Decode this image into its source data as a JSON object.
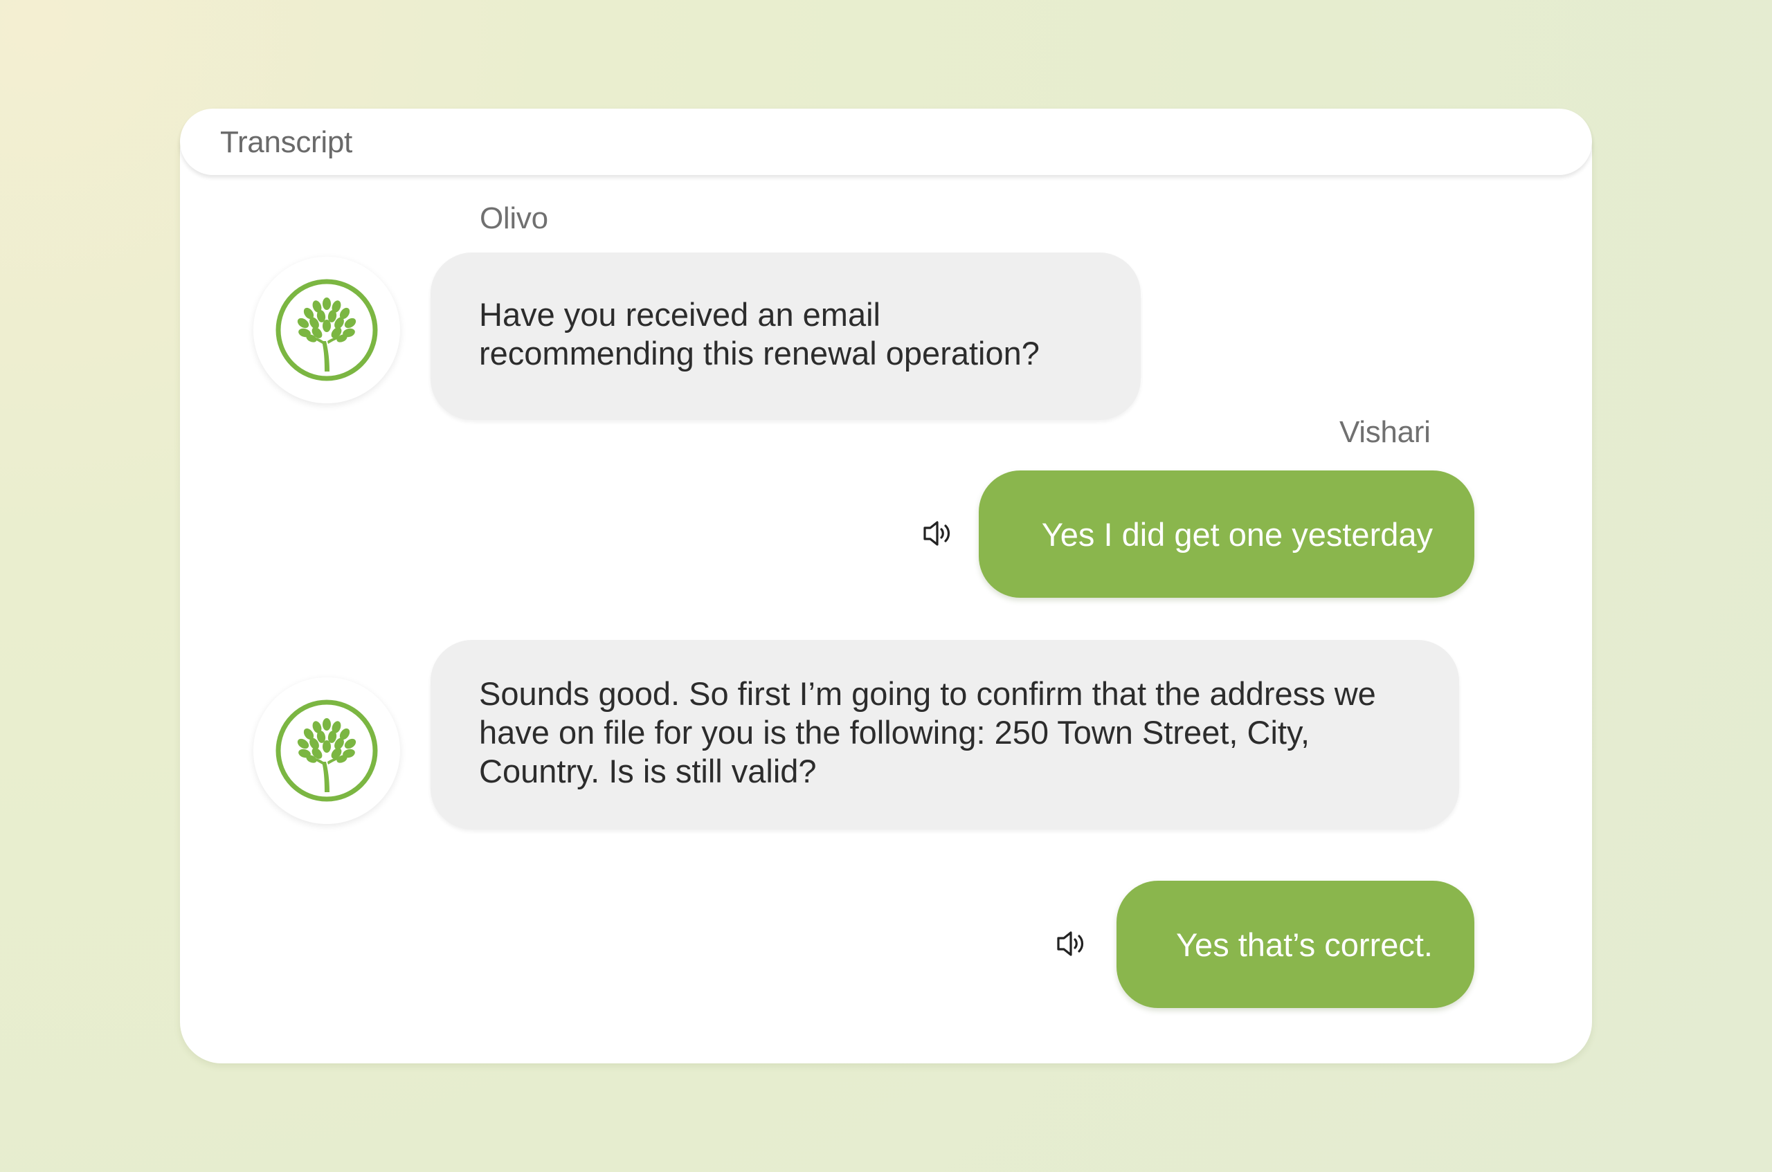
{
  "transcript": {
    "title": "Transcript"
  },
  "messages": [
    {
      "role": "bot",
      "sender": "Olivo",
      "text_lines": [
        "Have you received an email",
        "recommending this renewal operation?"
      ],
      "avatar_icon": "tree-logo-icon"
    },
    {
      "role": "user",
      "sender": "Vishari",
      "text": "Yes I did get one yesterday",
      "action_icon": "speaker-icon"
    },
    {
      "role": "bot",
      "text_lines": [
        "Sounds good. So first I’m going to confirm that the address we",
        "have on file for you is the following: 250 Town Street, City,",
        "Country. Is is still valid?"
      ],
      "avatar_icon": "tree-logo-icon"
    },
    {
      "role": "user",
      "text": "Yes that’s correct.",
      "action_icon": "speaker-icon"
    }
  ],
  "colors": {
    "user_bubble": "#8ab64d",
    "bot_bubble": "#efefef",
    "logo_green": "#7bb642"
  }
}
